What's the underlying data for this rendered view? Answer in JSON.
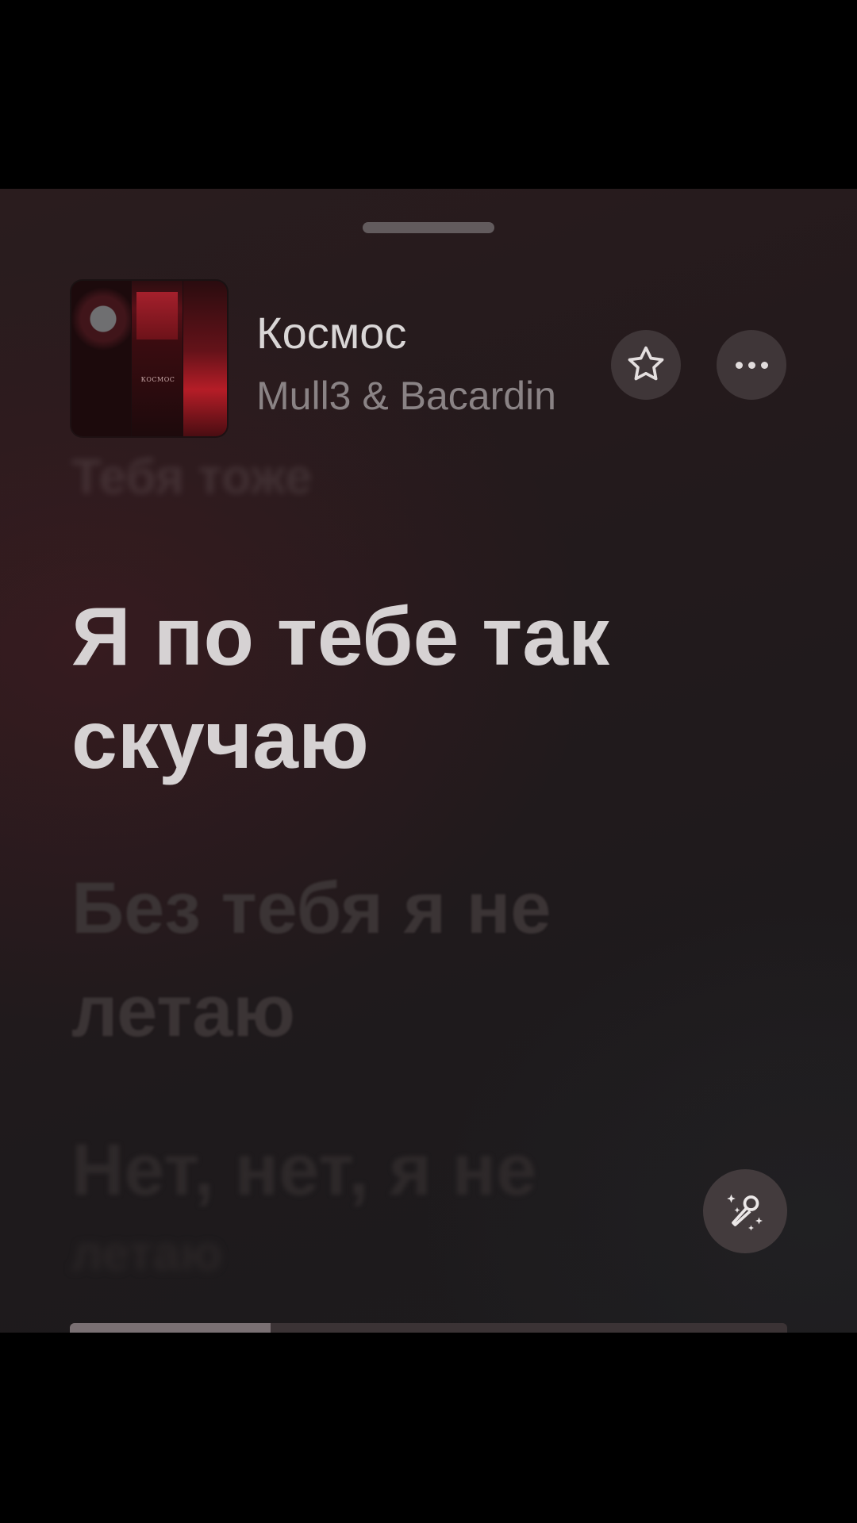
{
  "track": {
    "title": "Космос",
    "artist": "Mull3 & Bacardin",
    "cover_text": "КОСМОС",
    "artwork_icon": "album-artwork"
  },
  "actions": {
    "favorite_icon": "star-icon",
    "more_icon": "ellipsis-icon",
    "lyrics_mode_icon": "microphone-sparkles-icon"
  },
  "lyrics": {
    "previous": "Тебя тоже",
    "active": "Я по тебе так скучаю",
    "next": "Без тебя я не летаю",
    "following": "Нет, нет, я не",
    "following_2": "летаю"
  },
  "progress": {
    "fraction": 0.28
  },
  "colors": {
    "background": "#231a1c",
    "active_lyric": "#d6d2d3",
    "accent_artwork": "#b51d27"
  }
}
